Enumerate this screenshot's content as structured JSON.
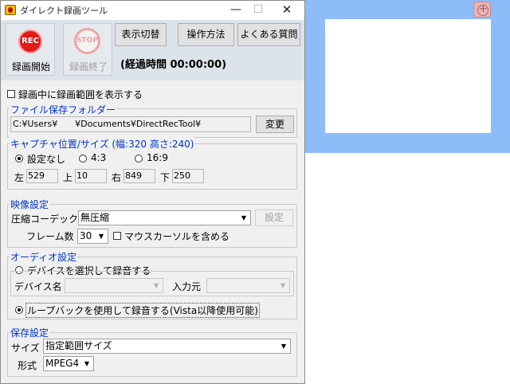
{
  "window": {
    "title": "ダイレクト録画ツール",
    "min": "—",
    "max": "☐",
    "close": "✕"
  },
  "toolbar": {
    "rec_icon": "REC",
    "rec_label": "録画開始",
    "stop_icon": "STOP",
    "stop_label": "録画終了",
    "display_toggle": "表示切替",
    "how_to": "操作方法",
    "faq": "よくある質問",
    "elapsed": "(経過時間 00:00:00)"
  },
  "show_range": {
    "label": "録画中に録画範囲を表示する",
    "checked": false
  },
  "folder": {
    "group": "ファイル保存フォルダー",
    "path": "C:¥Users¥　　¥Documents¥DirectRecTool¥",
    "change": "変更"
  },
  "capture": {
    "group": "キャプチャ位置/サイズ (幅:320  高さ:240)",
    "opt_none": "設定なし",
    "opt_43": "4:3",
    "opt_169": "16:9",
    "left_label": "左",
    "left": "529",
    "top_label": "上",
    "top": "10",
    "right_label": "右",
    "right": "849",
    "bottom_label": "下",
    "bottom": "250"
  },
  "video": {
    "group": "映像設定",
    "codec_label": "圧縮コーデック",
    "codec": "無圧縮",
    "settings": "設定",
    "fps_label": "フレーム数",
    "fps": "30",
    "cursor_label": "マウスカーソルを含める"
  },
  "audio": {
    "group": "オーディオ設定",
    "device_opt": "デバイスを選択して録音する",
    "device_label": "デバイス名",
    "device": "",
    "input_label": "入力元",
    "input": "",
    "loopback_opt": "ループバックを使用して録音する(Vista以降使用可能)"
  },
  "save": {
    "group": "保存設定",
    "size_label": "サイズ",
    "size": "指定範囲サイズ",
    "format_label": "形式",
    "format": "MPEG4"
  },
  "icons": [
    "app-icon",
    "rec-icon",
    "stop-icon",
    "crosshair-icon"
  ],
  "colors": {
    "background_blue": "#8dbcf9",
    "group_label": "#0033cc",
    "rec_red": "#e21a1a"
  }
}
